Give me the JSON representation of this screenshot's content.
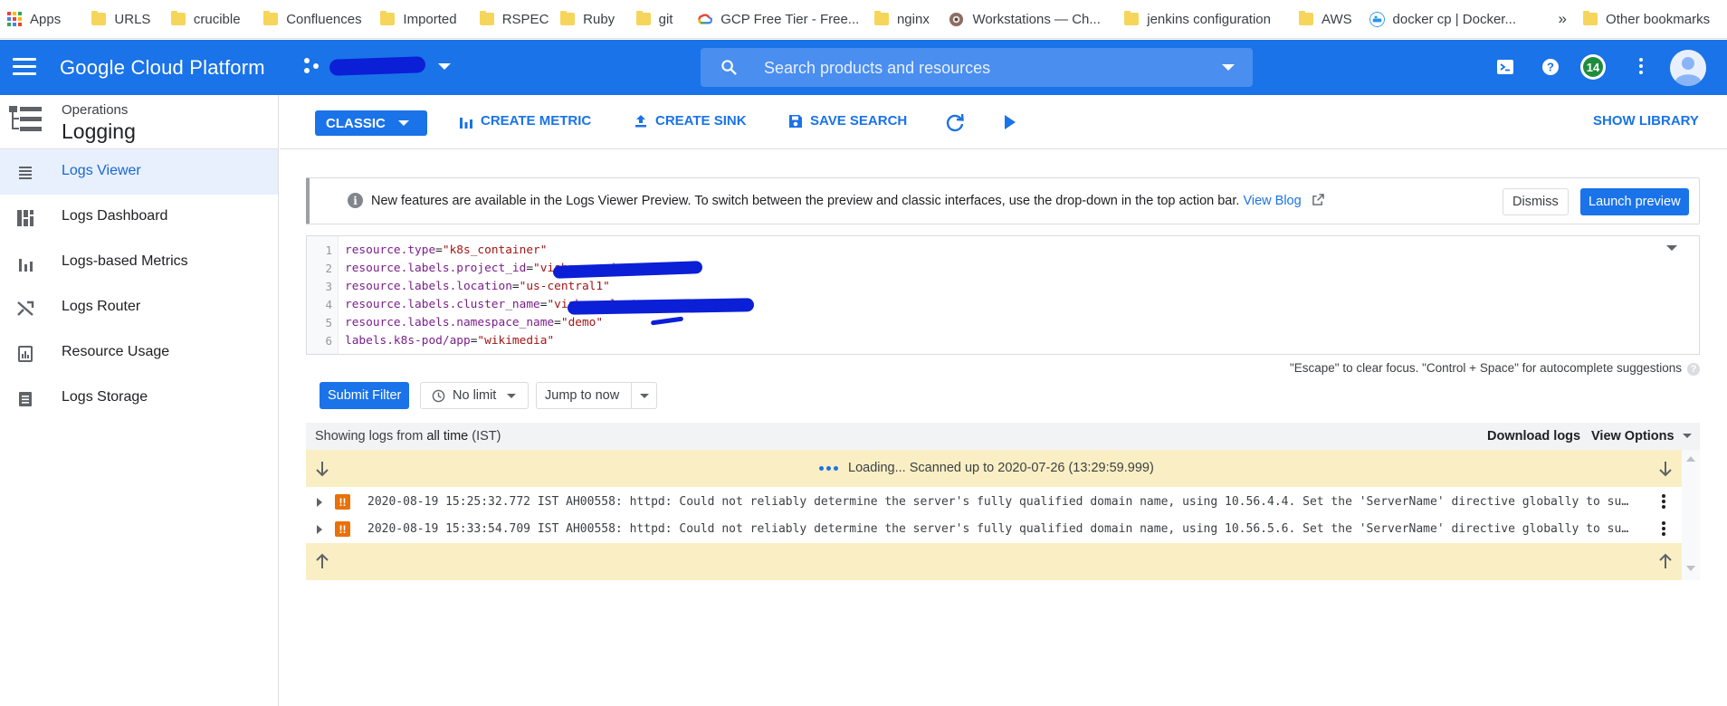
{
  "bookmarks": [
    {
      "label": "Apps",
      "icon": "apps-grid-icon"
    },
    {
      "label": "URLS",
      "icon": "folder-icon"
    },
    {
      "label": "crucible",
      "icon": "folder-icon"
    },
    {
      "label": "Confluences",
      "icon": "folder-icon"
    },
    {
      "label": "Imported",
      "icon": "folder-icon"
    },
    {
      "label": "RSPEC",
      "icon": "folder-icon"
    },
    {
      "label": "Ruby",
      "icon": "folder-icon"
    },
    {
      "label": "git",
      "icon": "folder-icon"
    },
    {
      "label": "GCP Free Tier - Free...",
      "icon": "google-cloud-icon"
    },
    {
      "label": "nginx",
      "icon": "folder-icon"
    },
    {
      "label": "Workstations — Ch...",
      "icon": "workstations-icon"
    },
    {
      "label": "jenkins configuration",
      "icon": "folder-icon"
    },
    {
      "label": "AWS",
      "icon": "folder-icon"
    },
    {
      "label": "docker cp | Docker...",
      "icon": "docker-icon"
    }
  ],
  "bookmarks_overflow": "»",
  "other_bookmarks": "Other bookmarks",
  "header": {
    "brand": "Google Cloud Platform",
    "search_placeholder": "Search products and resources",
    "notification_count": "14",
    "accent": "#1a73e8"
  },
  "sidenav": {
    "section": "Operations",
    "title": "Logging",
    "items": [
      {
        "label": "Logs Viewer",
        "icon": "list-icon",
        "active": true
      },
      {
        "label": "Logs Dashboard",
        "icon": "dashboard-icon"
      },
      {
        "label": "Logs-based Metrics",
        "icon": "bar-chart-icon"
      },
      {
        "label": "Logs Router",
        "icon": "router-icon"
      },
      {
        "label": "Resource Usage",
        "icon": "usage-icon"
      },
      {
        "label": "Logs Storage",
        "icon": "storage-icon"
      }
    ]
  },
  "toolbar": {
    "classic": "CLASSIC",
    "create_metric": "CREATE METRIC",
    "create_sink": "CREATE SINK",
    "save_search": "SAVE SEARCH",
    "show_library": "SHOW LIBRARY"
  },
  "banner": {
    "message": "New features are available in the Logs Viewer Preview. To switch between the preview and classic interfaces, use the drop-down in the top action bar.",
    "link": "View Blog",
    "dismiss": "Dismiss",
    "launch": "Launch preview"
  },
  "query": {
    "lines": [
      {
        "n": "1",
        "key": "resource.type",
        "val": "\"k8s_container\""
      },
      {
        "n": "2",
        "key": "resource.labels.project_id",
        "val": "\"vishnu-project-282903\""
      },
      {
        "n": "3",
        "key": "resource.labels.location",
        "val": "\"us-central1\""
      },
      {
        "n": "4",
        "key": "resource.labels.cluster_name",
        "val": "\"vishnu-cluster-2020-gke\""
      },
      {
        "n": "5",
        "key": "resource.labels.namespace_name",
        "val": "\"demo\""
      },
      {
        "n": "6",
        "key": "labels.k8s-pod/app",
        "val": "\"wikimedia\""
      }
    ],
    "hint": "\"Escape\" to clear focus. \"Control + Space\" for autocomplete suggestions"
  },
  "filters": {
    "submit": "Submit Filter",
    "limit": "No limit",
    "jump": "Jump to now"
  },
  "logs": {
    "showing_prefix": "Showing logs from ",
    "showing_range": "all time",
    "showing_tz": " (IST)",
    "download": "Download logs",
    "view_options": "View Options",
    "loading": "Loading... Scanned up to 2020-07-26 (13:29:59.999)",
    "rows": [
      {
        "text": "2020-08-19 15:25:32.772 IST  AH00558: httpd: Could not reliably determine the server's fully qualified domain name, using 10.56.4.4. Set the 'ServerName' directive globally to suppress this message"
      },
      {
        "text": "2020-08-19 15:33:54.709 IST  AH00558: httpd: Could not reliably determine the server's fully qualified domain name, using 10.56.5.6. Set the 'ServerName' directive globally to suppress this message"
      }
    ],
    "severity_glyph": "!!"
  }
}
